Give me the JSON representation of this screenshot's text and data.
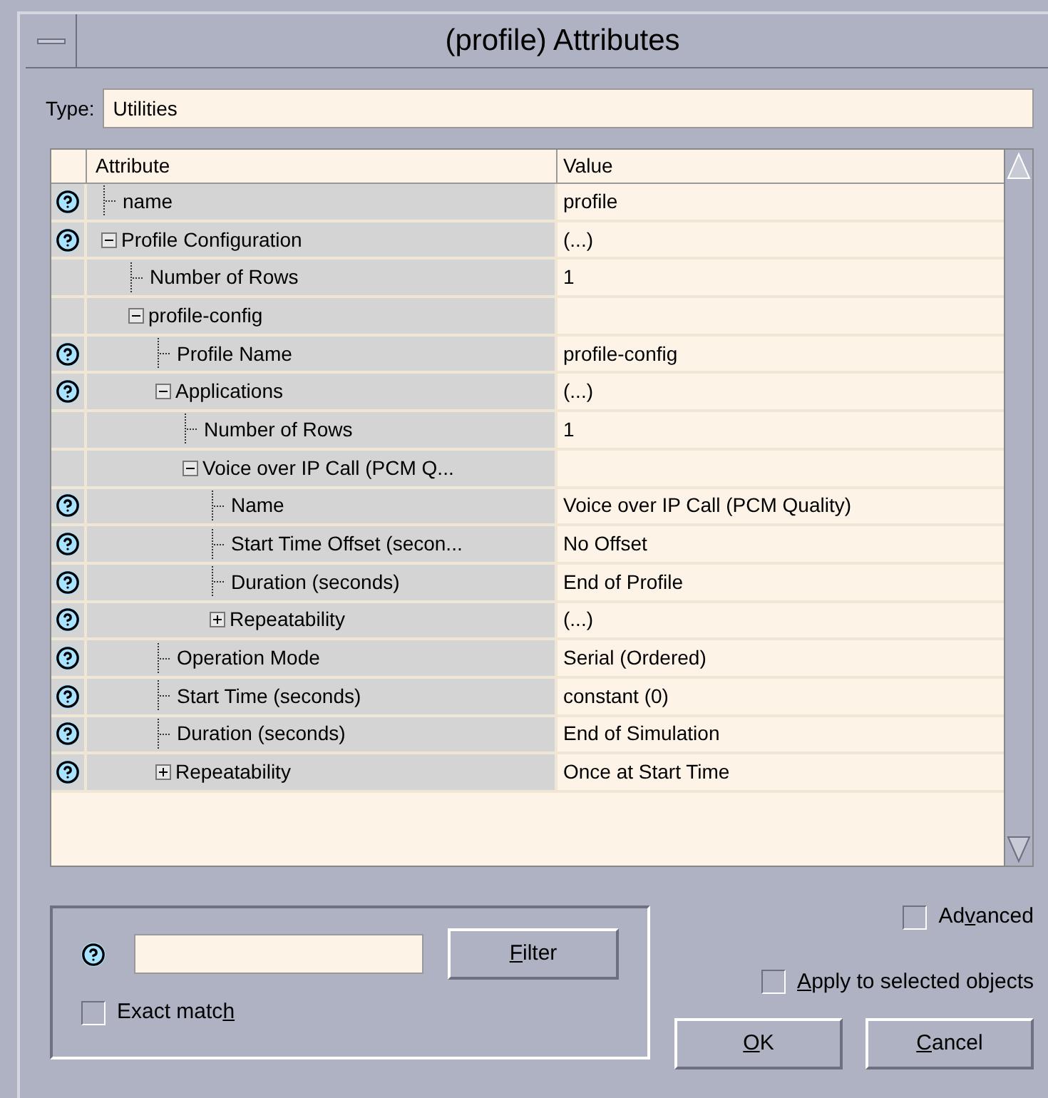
{
  "window": {
    "title": "(profile) Attributes"
  },
  "type_field": {
    "label": "Type:",
    "value": "Utilities"
  },
  "table": {
    "columns": [
      "Attribute",
      "Value"
    ],
    "rows": [
      {
        "attribute": "name",
        "value": "profile",
        "help": true
      },
      {
        "attribute": "Profile Configuration",
        "value": "(...)",
        "help": true,
        "expanded": true,
        "children": [
          {
            "attribute": "Number of Rows",
            "value": "1",
            "help": false
          },
          {
            "attribute": "profile-config",
            "help": false,
            "expanded": true,
            "children": [
              {
                "attribute": "Profile Name",
                "value": "profile-config",
                "help": true
              },
              {
                "attribute": "Applications",
                "value": "(...)",
                "help": true,
                "expanded": true,
                "children": [
                  {
                    "attribute": "Number of Rows",
                    "value": "1",
                    "help": false
                  },
                  {
                    "attribute": "Voice over IP Call (PCM Q...",
                    "help": false,
                    "expanded": true,
                    "children": [
                      {
                        "attribute": "Name",
                        "value": "Voice over IP Call (PCM Quality)",
                        "help": true
                      },
                      {
                        "attribute": "Start Time Offset (secon...",
                        "value": "No Offset",
                        "help": true
                      },
                      {
                        "attribute": "Duration (seconds)",
                        "value": "End of Profile",
                        "help": true
                      },
                      {
                        "attribute": "Repeatability",
                        "value": "(...)",
                        "help": true,
                        "expanded": false
                      }
                    ]
                  }
                ]
              },
              {
                "attribute": "Operation Mode",
                "value": "Serial (Ordered)",
                "help": true
              },
              {
                "attribute": "Start Time (seconds)",
                "value": "constant (0)",
                "help": true
              },
              {
                "attribute": "Duration (seconds)",
                "value": "End of Simulation",
                "help": true
              },
              {
                "attribute": "Repeatability",
                "value": "Once at Start Time",
                "help": true,
                "expanded": false
              }
            ]
          }
        ]
      }
    ]
  },
  "filter": {
    "button": {
      "label": {
        "key": "F",
        "after": "ilter"
      }
    },
    "exact_match": {
      "label": {
        "before": "Exact matc",
        "key": "h"
      },
      "checked": false
    }
  },
  "advanced": {
    "label": {
      "before": "Ad",
      "key": "v",
      "after": "anced"
    },
    "checked": false
  },
  "apply_selected": {
    "label": {
      "key": "A",
      "after": "pply to selected objects"
    },
    "checked": false
  },
  "buttons": [
    {
      "label": {
        "key": "O",
        "after": "K"
      }
    },
    {
      "label": {
        "key": "C",
        "after": "ancel"
      }
    }
  ]
}
